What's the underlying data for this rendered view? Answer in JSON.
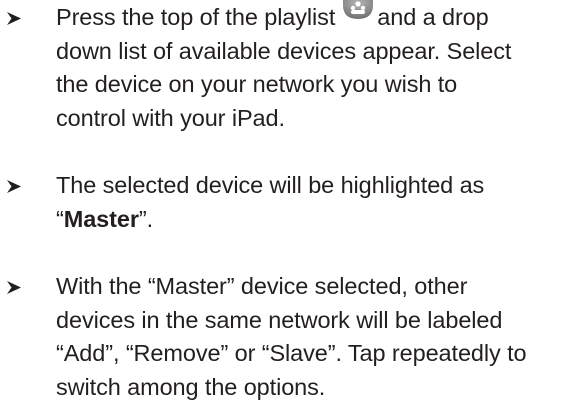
{
  "steps": [
    {
      "line1_before_icon": "Press the top of the playlist",
      "icon": "group-speakers-icon",
      "line1_after_icon": "and a drop",
      "line2": "down list of available devices appear. Select",
      "line3": "the device on your network you wish to",
      "line4": "control with your iPad."
    },
    {
      "line1": "The selected device will be highlighted as",
      "line2_open_quote": "“",
      "line2_bold": "Master",
      "line2_close": "”."
    },
    {
      "line1": "With the “Master” device selected, other",
      "line2": "devices in the same network will be labeled",
      "line3": "“Add”, “Remove” or “Slave”.  Tap repeatedly to",
      "line4": "switch among the options."
    }
  ],
  "bullet_icon": "arrowhead-bullet-icon",
  "colors": {
    "text": "#231f20",
    "background": "#ffffff",
    "icon_fill": "#8a8a8a"
  }
}
